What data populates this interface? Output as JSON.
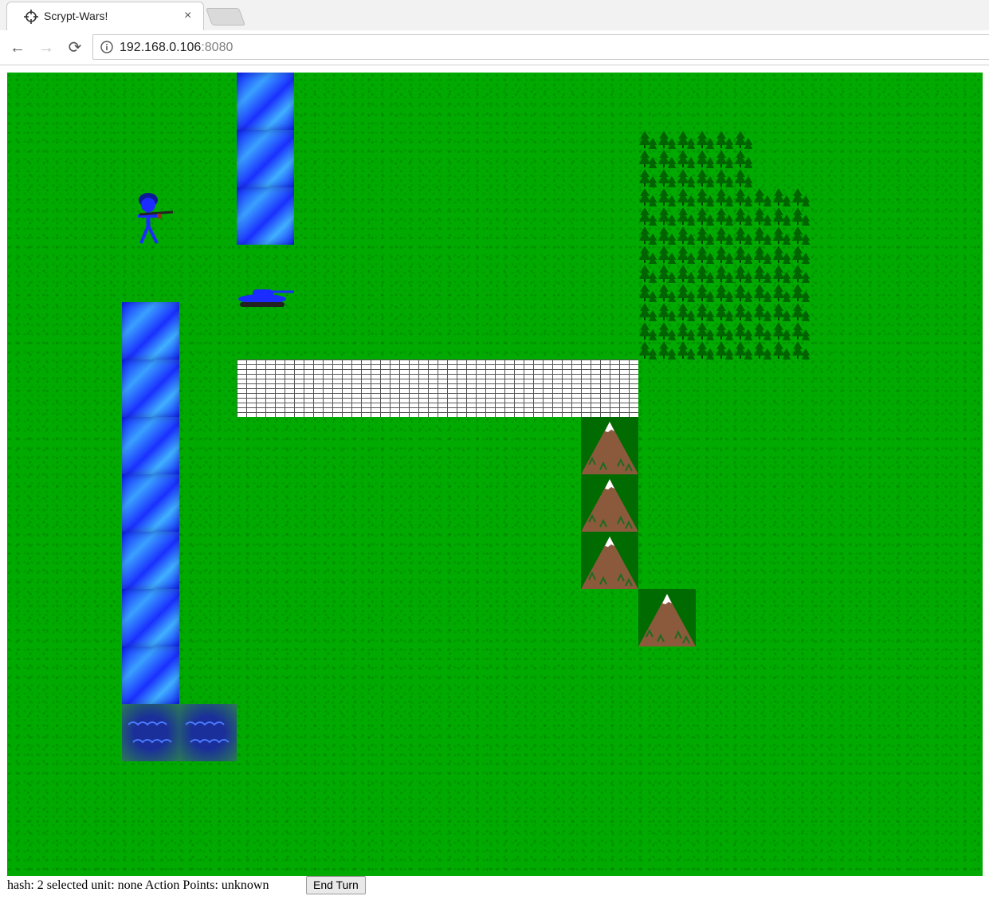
{
  "browser": {
    "tab_title": "Scrypt-Wars!",
    "tab_close": "×",
    "url_host": "192.168.0.106",
    "url_port": ":8080",
    "back": "←",
    "forward": "→",
    "reload": "⟳"
  },
  "status": {
    "hash_label": "hash:",
    "hash_value": "2",
    "selected_label": "selected unit:",
    "selected_value": "none",
    "ap_label": "Action Points:",
    "ap_value": "unknown",
    "end_turn_label": "End Turn"
  },
  "map": {
    "terrain_colors": {
      "grass": "#00aa00",
      "water": "#1a30ff",
      "wall": "#ffffff",
      "forest": "#006600",
      "mountain": "#8b5a3c"
    },
    "units": [
      {
        "type": "infantry",
        "icon": "soldier-icon",
        "color": "#1a2cff"
      },
      {
        "type": "tank",
        "icon": "tank-icon",
        "color": "#1a2cff"
      }
    ]
  }
}
